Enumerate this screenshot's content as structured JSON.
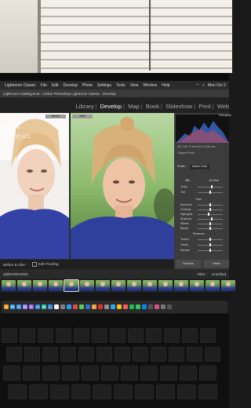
{
  "menubar": {
    "items": [
      "Lightroom Classic",
      "File",
      "Edit",
      "Develop",
      "Photo",
      "Settings",
      "Tools",
      "View",
      "Window",
      "Help"
    ],
    "clock": "Mon Oct 2"
  },
  "titlebar": {
    "text": "Lightroom Catalog.lrcat - Adobe Photoshop Lightroom Classic - Develop"
  },
  "modules": [
    "Library",
    "Develop",
    "Map",
    "Book",
    "Slideshow",
    "Print",
    "Web"
  ],
  "active_module": "Develop",
  "view": {
    "before_label": "Before",
    "after_label": "After",
    "stamp_line1": "S-50-Ja",
    "stamp_line2": "(A1/3)",
    "stamp_line3": "100 ISO 12:1"
  },
  "toolbar": {
    "before_after_label": "Before & After :",
    "soft_proofing_label": "Soft Proofing"
  },
  "right_panel": {
    "histogram_label": "Histogram",
    "meta": {
      "iso": "ISO 200",
      "focal": "70 mm",
      "aperture": "f/2.8",
      "shutter": "1/640 sec"
    },
    "original_photo": "Original Photo",
    "profile_label": "Profile :",
    "profile_value": "Adobe Color",
    "wb_label": "WB :",
    "wb_value": "As Shot",
    "sliders_wb": [
      {
        "name": "Temp",
        "pos": 0.55
      },
      {
        "name": "Tint",
        "pos": 0.5
      }
    ],
    "tone_label": "Tone",
    "sliders_tone": [
      {
        "name": "Exposure",
        "pos": 0.5
      },
      {
        "name": "Contrast",
        "pos": 0.5
      },
      {
        "name": "Highlights",
        "pos": 0.45
      },
      {
        "name": "Shadows",
        "pos": 0.55
      },
      {
        "name": "Whites",
        "pos": 0.5
      },
      {
        "name": "Blacks",
        "pos": 0.5
      }
    ],
    "presence_label": "Presence",
    "sliders_presence": [
      {
        "name": "Texture",
        "pos": 0.5
      },
      {
        "name": "Clarity",
        "pos": 0.5
      },
      {
        "name": "Dehaze",
        "pos": 0.5
      }
    ],
    "previous_label": "Previous",
    "reset_label": "Reset"
  },
  "filmstrip_bar": {
    "folder": "addSAR5ADRX",
    "filter_label": "Filter :",
    "filter_value": "Unedited"
  },
  "filmstrip": {
    "count": 15,
    "selected_index": 4
  },
  "dock": {
    "apps": [
      {
        "label": "Ai",
        "color": "#f7a21b"
      },
      {
        "label": "Ps",
        "color": "#2fa7f6"
      },
      {
        "label": "Lr",
        "color": "#3aa0e8"
      },
      {
        "label": "Ae",
        "color": "#9b84ff"
      },
      {
        "label": "Pr",
        "color": "#9a6cf0"
      },
      {
        "label": "Lrc",
        "color": "#2c8fe0"
      },
      {
        "label": "Au",
        "color": "#2fc8a6"
      },
      {
        "label": "",
        "color": "#4a90e2"
      },
      {
        "label": "",
        "color": "#ffffff"
      },
      {
        "label": "",
        "color": "#7f7f7f"
      },
      {
        "label": "",
        "color": "#2c9cf2"
      },
      {
        "label": "",
        "color": "#e04848"
      },
      {
        "label": "",
        "color": "#5ac85a"
      },
      {
        "label": "",
        "color": "#2f6ce0"
      },
      {
        "label": "",
        "color": "#f2a33a"
      },
      {
        "label": "",
        "color": "#e23030"
      },
      {
        "label": "",
        "color": "#8e8e93"
      },
      {
        "label": "",
        "color": "#2aa8f0"
      },
      {
        "label": "",
        "color": "#f0c020"
      },
      {
        "label": "",
        "color": "#ff5a5f"
      },
      {
        "label": "",
        "color": "#1db954"
      },
      {
        "label": "",
        "color": "#34c759"
      },
      {
        "label": "",
        "color": "#0a84ff"
      },
      {
        "label": "",
        "color": "#555555"
      },
      {
        "label": "",
        "color": "#d94c8a"
      },
      {
        "label": "",
        "color": "#777777"
      },
      {
        "label": "",
        "color": "#555555"
      }
    ]
  },
  "colors": {
    "accent": "#f4f4f4",
    "panel": "#3c3c3c",
    "shirt": "#2f3f9c"
  }
}
